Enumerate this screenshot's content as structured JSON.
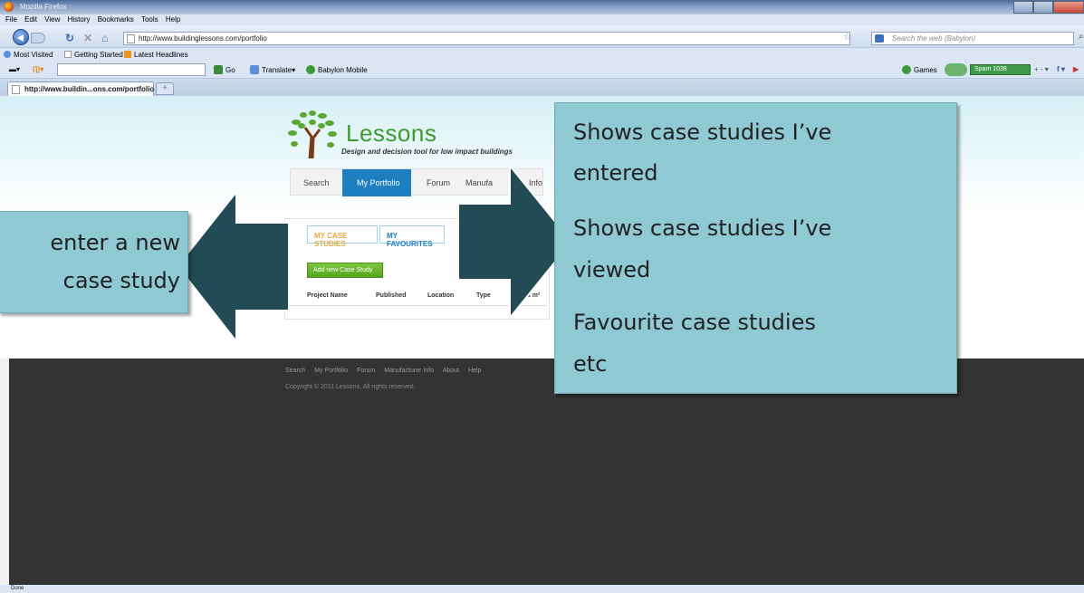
{
  "browser": {
    "window_title": "Mozilla Firefox",
    "menu": [
      "File",
      "Edit",
      "View",
      "History",
      "Bookmarks",
      "Tools",
      "Help"
    ],
    "url": "http://www.buildinglessons.com/portfolio",
    "search_placeholder": "Search the web (Babylon)",
    "bookmarks": [
      "Most Visited",
      "Getting Started",
      "Latest Headlines"
    ],
    "toolbar": {
      "go": "Go",
      "translate": "Translate",
      "babylon": "Babylon Mobile",
      "games": "Games",
      "spam": "Spam 1038"
    },
    "tab_title": "http://www.buildin...ons.com/portfolio",
    "new_tab": "+",
    "status": "Done"
  },
  "site": {
    "logo_word": "Lessons",
    "tagline": "Design and decision tool for low impact buildings",
    "nav": [
      "Search",
      "My Portfolio",
      "Forum",
      "Manufa",
      "Info"
    ],
    "nav_active": "My Portfolio",
    "tabs": [
      "MY CASE STUDIES",
      "MY FAVOURITES"
    ],
    "add_button": "Add new Case Study",
    "columns": [
      "Project Name",
      "Published",
      "Location",
      "Type",
      "ea m²"
    ],
    "footer_links": [
      "Search",
      "My Portfolio",
      "Forum",
      "Manufacturer Info",
      "About",
      "Help"
    ],
    "copyright": "Copyright © 2011 Lessons, All rights reserved."
  },
  "annotations": {
    "left": [
      "enter a new",
      "case study"
    ],
    "right": [
      "Shows case studies I’ve",
      "entered",
      "Shows case studies I’ve",
      "viewed",
      "Favourite case studies",
      "etc"
    ]
  },
  "colors": {
    "callout": "#8fc9d3",
    "arrow": "#234b55",
    "nav_active": "#1d7fbf",
    "footer": "#333333"
  }
}
